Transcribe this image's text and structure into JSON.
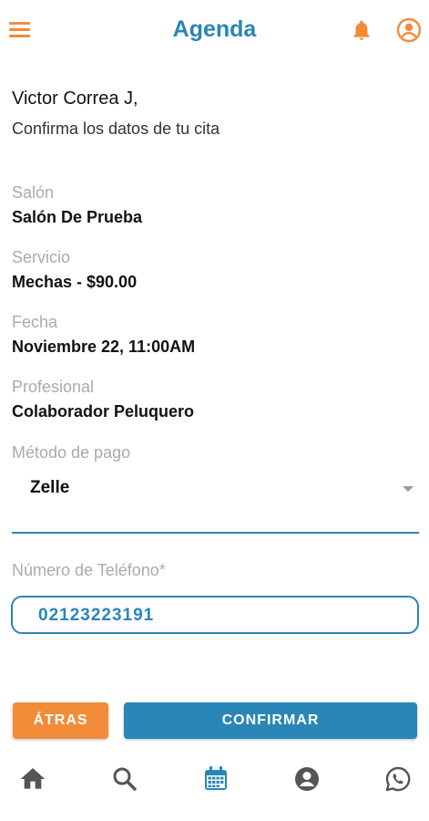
{
  "header": {
    "title": "Agenda",
    "menu_icon": "hamburger-menu-icon",
    "notification_icon": "bell-icon",
    "account_icon": "account-circle-icon"
  },
  "greeting": {
    "name": "Victor Correa J,",
    "subtitle": "Confirma los datos de tu cita"
  },
  "details": {
    "salon_label": "Salón",
    "salon_value": "Salón De Prueba",
    "service_label": "Servicio",
    "service_value": "Mechas - $90.00",
    "date_label": "Fecha",
    "date_value": "Noviembre 22, 11:00AM",
    "professional_label": "Profesional",
    "professional_value": "Colaborador Peluquero"
  },
  "payment": {
    "label": "Método de pago",
    "selected": "Zelle"
  },
  "phone": {
    "label": "Número de Teléfono*",
    "value": "02123223191"
  },
  "actions": {
    "back_label": "ÁTRAS",
    "confirm_label": "CONFIRMAR"
  },
  "bottom_nav": {
    "items": [
      "home-icon",
      "search-icon",
      "calendar-icon",
      "profile-icon",
      "whatsapp-icon"
    ],
    "active": "calendar-icon"
  },
  "colors": {
    "primary": "#2A86B6",
    "accent": "#F28C38",
    "label_gray": "#AAAAAA",
    "nav_gray": "#555555"
  }
}
